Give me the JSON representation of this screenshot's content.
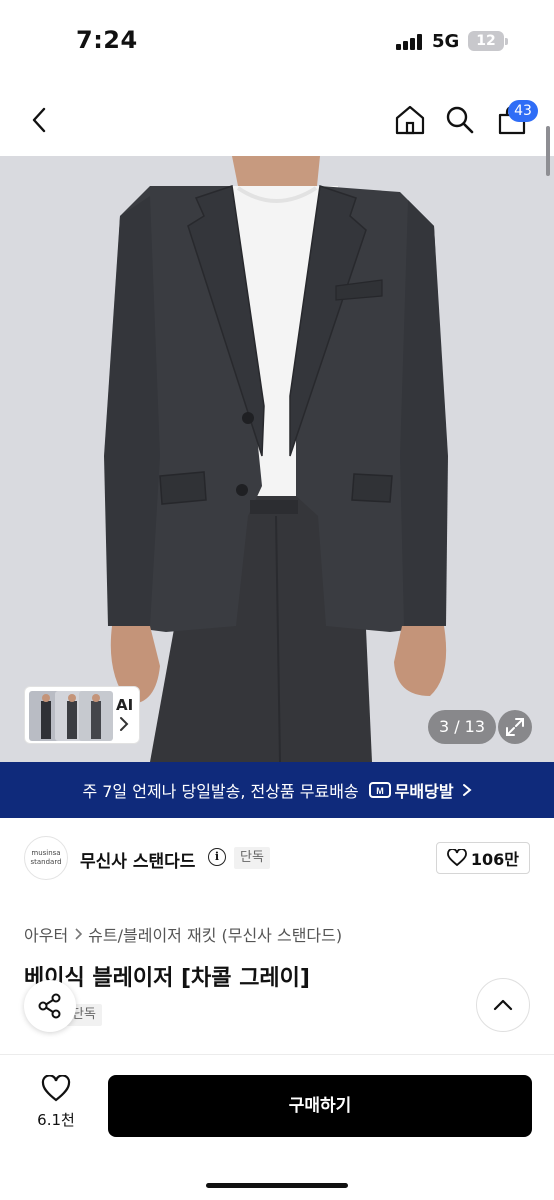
{
  "status_bar": {
    "time": "7:24",
    "network": "5G",
    "battery": "12"
  },
  "nav": {
    "cart_count": "43"
  },
  "gallery": {
    "ai_label": "AI",
    "counter": "3 / 13"
  },
  "shipping_banner": {
    "text": "주 7일 언제나 당일발송, 전상품 무료배송",
    "badge": "무배당발"
  },
  "brand": {
    "logo_line1": "musinsa",
    "logo_line2": "standard",
    "name": "무신사 스탠다드",
    "exclusive_tag": "단독",
    "likes": "106만"
  },
  "product": {
    "breadcrumb": [
      "아우터",
      "슈트/블레이저 재킷 (무신사 스탠다드)"
    ],
    "title": "베이식 블레이저 [차콜 그레이]",
    "tag": "단독"
  },
  "bottom_bar": {
    "like_count": "6.1천",
    "buy_label": "구매하기"
  },
  "colors": {
    "banner_bg": "#0f2a7b",
    "badge_blue": "#2f6df6",
    "buy_bg": "#000000",
    "jacket": "#3a3c41",
    "hero_bg": "#d9dadf"
  }
}
